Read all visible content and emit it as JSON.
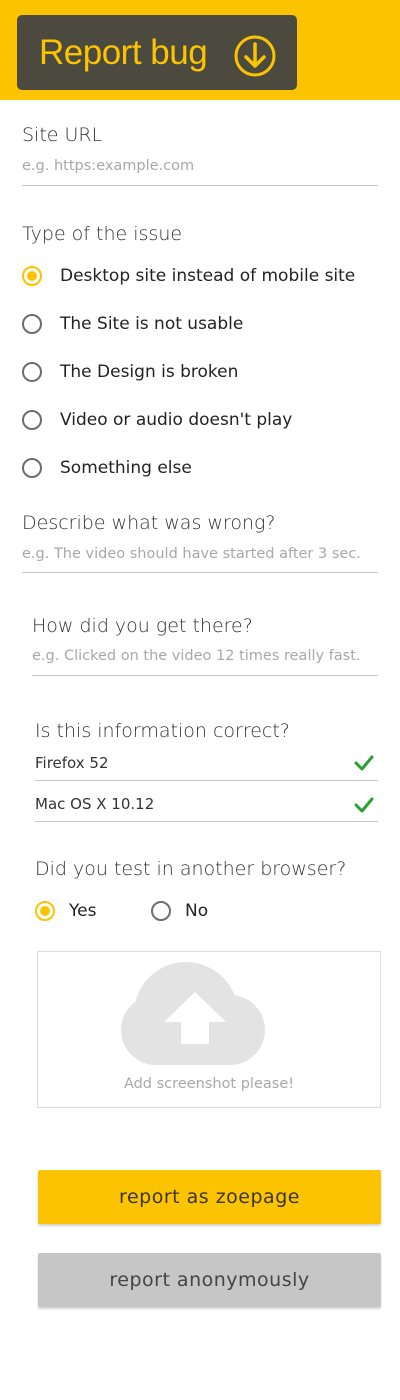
{
  "header": {
    "title": "Report bug",
    "icon": "download-circle-icon",
    "bg_color": "#fcc400",
    "box_color": "#4c4a3f"
  },
  "site_url": {
    "label": "Site URL",
    "placeholder": "e.g. https:example.com"
  },
  "issue_type": {
    "label": "Type of the issue",
    "options": [
      {
        "label": "Desktop site instead of mobile site",
        "checked": true
      },
      {
        "label": "The Site is not usable",
        "checked": false
      },
      {
        "label": "The Design is broken",
        "checked": false
      },
      {
        "label": "Video or audio doesn't play",
        "checked": false
      },
      {
        "label": "Something else",
        "checked": false
      }
    ]
  },
  "describe": {
    "label": "Describe what was wrong?",
    "placeholder": "e.g. The video should have started after 3 sec."
  },
  "steps": {
    "label": "How did you get there?",
    "placeholder": "e.g. Clicked on the video 12 times really fast."
  },
  "info_check": {
    "label": "Is this information correct?",
    "items": [
      {
        "value": "Firefox 52",
        "icon": "checkmark-icon"
      },
      {
        "value": "Mac OS X 10.12",
        "icon": "checkmark-icon"
      }
    ]
  },
  "other_browser": {
    "label": "Did you test in another browser?",
    "options": [
      {
        "label": "Yes",
        "checked": true
      },
      {
        "label": "No",
        "checked": false
      }
    ]
  },
  "upload": {
    "text": "Add screenshot please!",
    "icon": "cloud-upload-icon"
  },
  "buttons": {
    "primary": "report as zoepage",
    "secondary": "report anonymously"
  },
  "colors": {
    "accent": "#fcc400",
    "check": "#2ca02c",
    "secondary_button": "#c6c6c6"
  }
}
